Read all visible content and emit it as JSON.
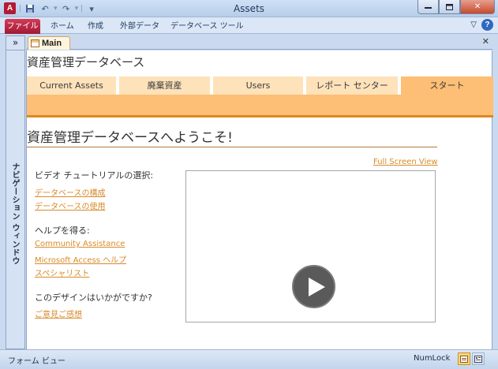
{
  "window": {
    "title": "Assets",
    "logo_letter": "A"
  },
  "ribbon": {
    "tabs": [
      {
        "label": "ファイル"
      },
      {
        "label": "ホーム"
      },
      {
        "label": "作成"
      },
      {
        "label": "外部データ"
      },
      {
        "label": "データベース ツール"
      }
    ]
  },
  "nav_pane": {
    "toggle": "»",
    "label": "ナビゲーション ウィンドウ"
  },
  "document": {
    "tab_label": "Main",
    "form_title": "資産管理データベース",
    "tabs": [
      {
        "label": "Current Assets",
        "active": false
      },
      {
        "label": "廃棄資産",
        "active": false
      },
      {
        "label": "Users",
        "active": false
      },
      {
        "label": "レポート センター",
        "active": false
      },
      {
        "label": "スタート",
        "active": true
      }
    ],
    "welcome": "資産管理データベースへようこそ!",
    "fullscreen_link": "Full Screen View",
    "video_section": {
      "label": "ビデオ チュートリアルの選択:",
      "links": [
        "データベースの構成",
        "データベースの使用"
      ]
    },
    "help_section": {
      "label": "ヘルプを得る:",
      "links": [
        "Community Assistance",
        "Microsoft Access ヘルプ",
        "スペシャリスト"
      ]
    },
    "feedback_section": {
      "label": "このデザインはいかがですか?",
      "link": "ご意見ご感想"
    }
  },
  "status_bar": {
    "view_name": "フォーム ビュー",
    "numlock": "NumLock"
  },
  "colors": {
    "tab_inactive": "#fee2ba",
    "tab_active": "#fdbe75",
    "band_border": "#e0861f",
    "link": "#d88a2a",
    "file_tab": "#b31b34"
  }
}
